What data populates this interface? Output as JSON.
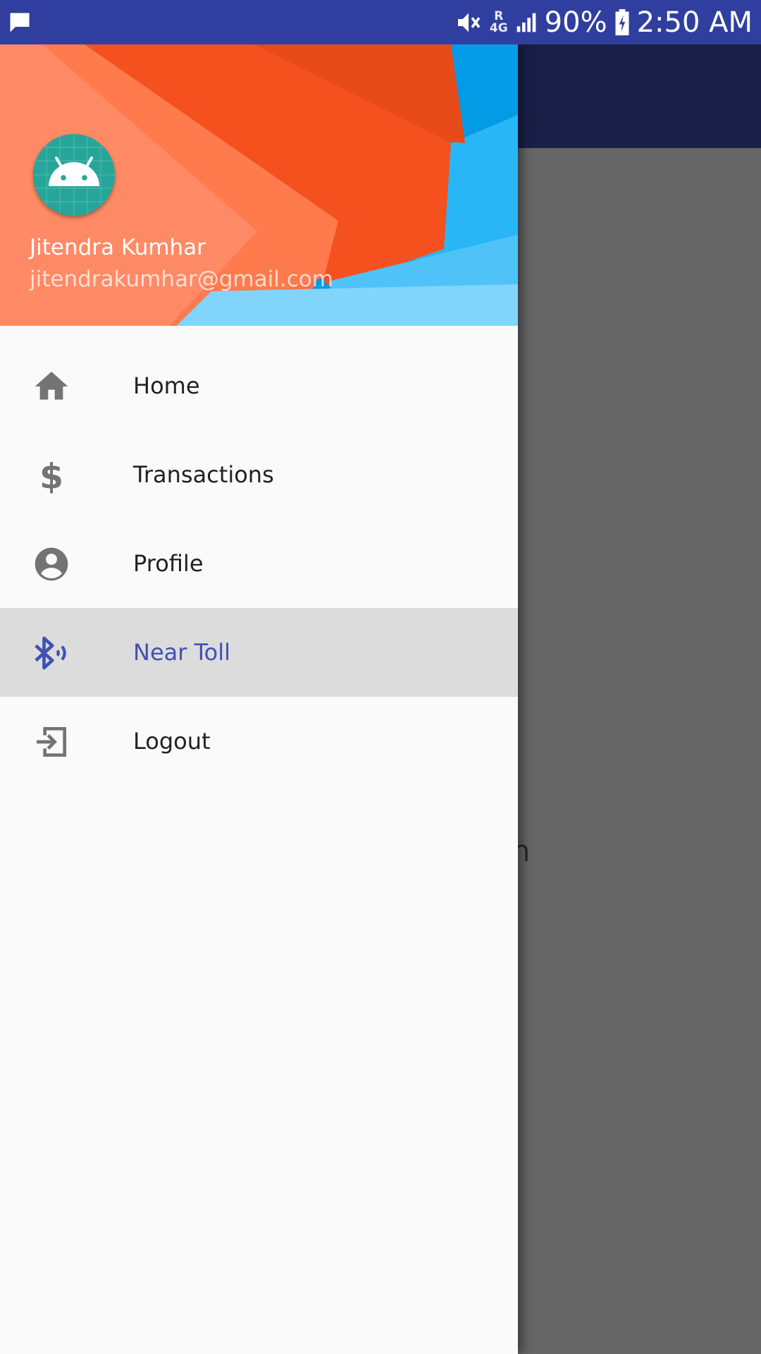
{
  "status_bar": {
    "network_type": "4G",
    "roaming_indicator": "R",
    "battery_percent": "90%",
    "time": "2:50 AM",
    "icons": [
      "message-icon",
      "vibrate-off-icon",
      "signal-icon",
      "battery-charging-icon"
    ]
  },
  "background": {
    "partial_text": "on"
  },
  "drawer": {
    "header": {
      "user_name": "Jitendra Kumhar",
      "user_email": "jitendrakumhar@gmail.com",
      "avatar_icon": "android-icon"
    },
    "items": [
      {
        "label": "Home",
        "icon": "home-icon",
        "selected": false
      },
      {
        "label": "Transactions",
        "icon": "dollar-icon",
        "selected": false
      },
      {
        "label": "Profile",
        "icon": "account-circle-icon",
        "selected": false
      },
      {
        "label": "Near Toll",
        "icon": "bluetooth-audio-icon",
        "selected": true
      },
      {
        "label": "Logout",
        "icon": "exit-icon",
        "selected": false
      }
    ]
  },
  "colors": {
    "status_bar": "#303F9F",
    "app_bar": "#1A1F47",
    "accent": "#3F51B5",
    "selected_bg": "#DCDCDC",
    "scrim": "#666666",
    "avatar_bg": "#26A69A"
  }
}
